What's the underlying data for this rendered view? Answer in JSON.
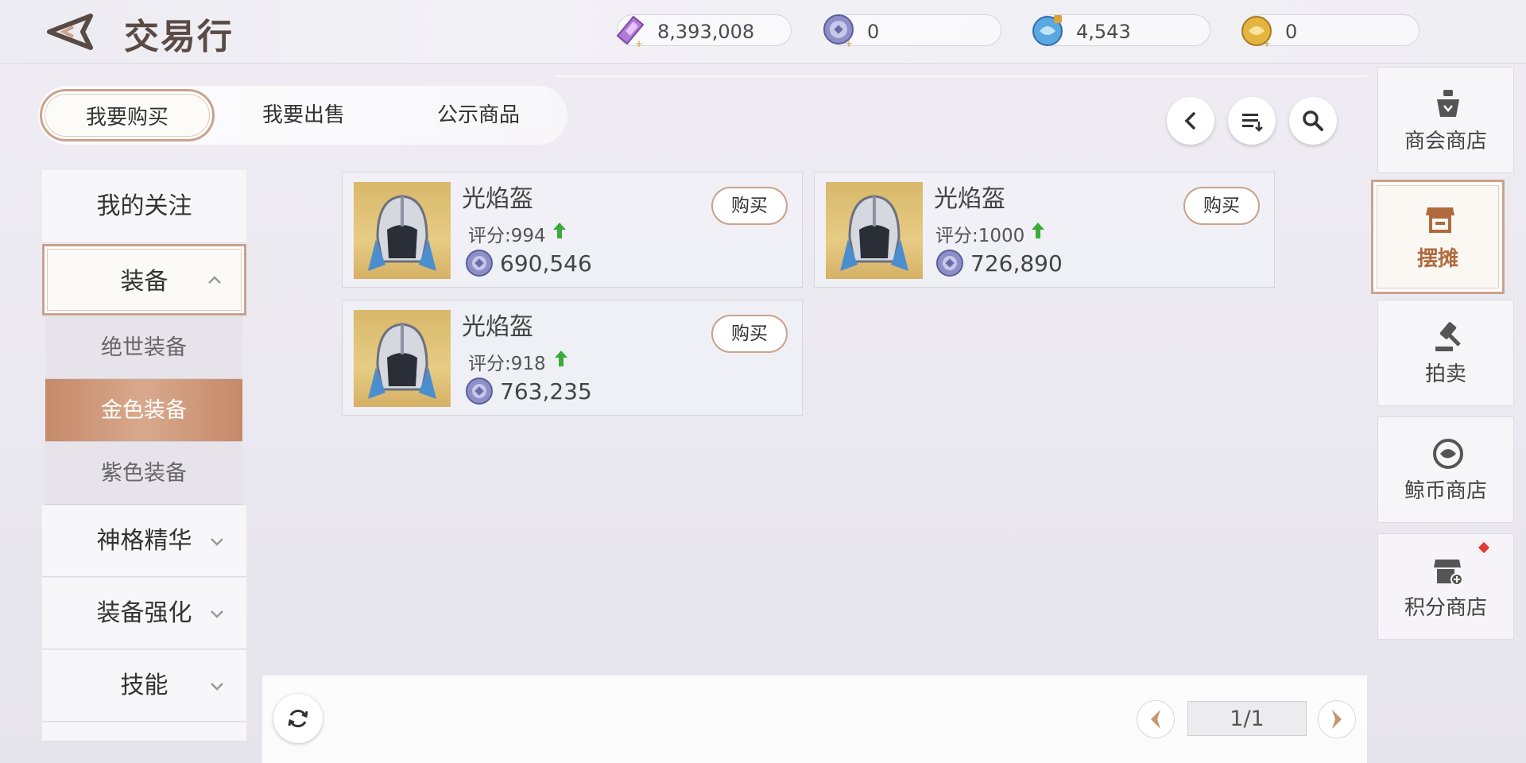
{
  "header": {
    "title": "交易行",
    "currencies": [
      {
        "icon": "purple-gem-icon",
        "value": "8,393,008"
      },
      {
        "icon": "silver-coin-icon",
        "value": "0"
      },
      {
        "icon": "blue-whale-coin-icon",
        "value": "4,543"
      },
      {
        "icon": "gold-whale-coin-icon",
        "value": "0"
      }
    ]
  },
  "tabs": [
    {
      "label": "我要购买",
      "active": true
    },
    {
      "label": "我要出售",
      "active": false
    },
    {
      "label": "公示商品",
      "active": false
    }
  ],
  "toolbar": {
    "back_icon": "chevron-left-icon",
    "sort_icon": "sort-list-icon",
    "search_icon": "search-icon"
  },
  "sidebar": {
    "favorites": "我的关注",
    "equipment": "装备",
    "subcategories": [
      {
        "label": "绝世装备",
        "active": false
      },
      {
        "label": "金色装备",
        "active": true
      },
      {
        "label": "紫色装备",
        "active": false
      }
    ],
    "divine": "神格精华",
    "enhance": "装备强化",
    "skills": "技能"
  },
  "items": [
    {
      "name": "光焰盔",
      "score": "评分:994",
      "price": "690,546",
      "buy": "购买"
    },
    {
      "name": "光焰盔",
      "score": "评分:1000",
      "price": "726,890",
      "buy": "购买"
    },
    {
      "name": "光焰盔",
      "score": "评分:918",
      "price": "763,235",
      "buy": "购买"
    }
  ],
  "pagination": {
    "indicator": "1/1"
  },
  "right_nav": [
    {
      "label": "商会商店",
      "icon": "shop-scale-icon",
      "active": false
    },
    {
      "label": "摆摊",
      "icon": "stall-icon",
      "active": true
    },
    {
      "label": "拍卖",
      "icon": "gavel-icon",
      "active": false
    },
    {
      "label": "鲸币商店",
      "icon": "whale-coin-icon",
      "active": false
    },
    {
      "label": "积分商店",
      "icon": "points-shop-icon",
      "active": false,
      "badge": true
    }
  ],
  "colors": {
    "accent": "#c9a38d",
    "active_sub": "#c58a6a",
    "up": "#3aaa3a"
  }
}
